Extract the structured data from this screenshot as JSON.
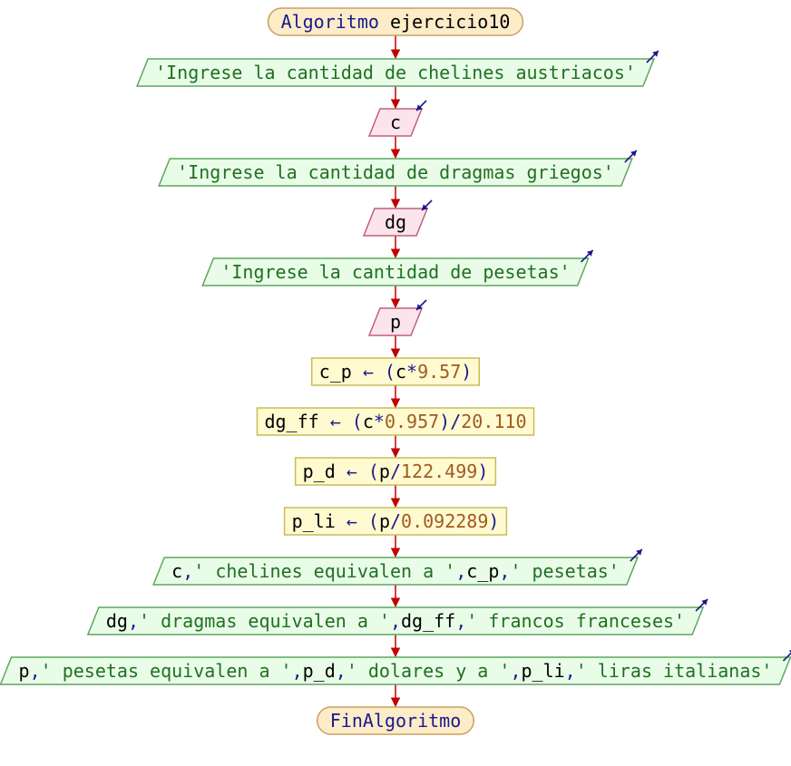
{
  "colors": {
    "edge": "#c00000",
    "terminal_fill": "#fcecc8",
    "terminal_stroke": "#c8a060",
    "output_fill": "#e8fce8",
    "output_stroke": "#5fa65f",
    "input_fill": "#fce4ec",
    "input_stroke": "#c0607a",
    "process_fill": "#fffad0",
    "process_stroke": "#c8bc58",
    "keyword": "#1a1a8c",
    "string": "#207020",
    "variable": "#000000",
    "number": "#a05a20",
    "io_arrow": "#1a1a8c"
  },
  "nodes": [
    {
      "id": "start",
      "type": "terminal",
      "tokens": [
        {
          "t": "Algoritmo",
          "k": "keyword"
        },
        {
          "t": " ejercicio10",
          "k": "variable"
        }
      ]
    },
    {
      "id": "out1",
      "type": "output",
      "tokens": [
        {
          "t": "'Ingrese la cantidad de chelines austriacos'",
          "k": "string"
        }
      ]
    },
    {
      "id": "in1",
      "type": "input",
      "tokens": [
        {
          "t": "c",
          "k": "variable"
        }
      ]
    },
    {
      "id": "out2",
      "type": "output",
      "tokens": [
        {
          "t": "'Ingrese la cantidad de dragmas griegos'",
          "k": "string"
        }
      ]
    },
    {
      "id": "in2",
      "type": "input",
      "tokens": [
        {
          "t": "dg",
          "k": "variable"
        }
      ]
    },
    {
      "id": "out3",
      "type": "output",
      "tokens": [
        {
          "t": "'Ingrese la cantidad de pesetas'",
          "k": "string"
        }
      ]
    },
    {
      "id": "in3",
      "type": "input",
      "tokens": [
        {
          "t": "p",
          "k": "variable"
        }
      ]
    },
    {
      "id": "proc1",
      "type": "process",
      "tokens": [
        {
          "t": "c_p",
          "k": "variable"
        },
        {
          "t": " ← (",
          "k": "keyword"
        },
        {
          "t": "c",
          "k": "variable"
        },
        {
          "t": "*",
          "k": "keyword"
        },
        {
          "t": "9.57",
          "k": "number"
        },
        {
          "t": ")",
          "k": "keyword"
        }
      ]
    },
    {
      "id": "proc2",
      "type": "process",
      "tokens": [
        {
          "t": "dg_ff",
          "k": "variable"
        },
        {
          "t": " ← (",
          "k": "keyword"
        },
        {
          "t": "c",
          "k": "variable"
        },
        {
          "t": "*",
          "k": "keyword"
        },
        {
          "t": "0.957",
          "k": "number"
        },
        {
          "t": ")/",
          "k": "keyword"
        },
        {
          "t": "20.110",
          "k": "number"
        }
      ]
    },
    {
      "id": "proc3",
      "type": "process",
      "tokens": [
        {
          "t": "p_d",
          "k": "variable"
        },
        {
          "t": " ← (",
          "k": "keyword"
        },
        {
          "t": "p",
          "k": "variable"
        },
        {
          "t": "/",
          "k": "keyword"
        },
        {
          "t": "122.499",
          "k": "number"
        },
        {
          "t": ")",
          "k": "keyword"
        }
      ]
    },
    {
      "id": "proc4",
      "type": "process",
      "tokens": [
        {
          "t": "p_li",
          "k": "variable"
        },
        {
          "t": " ← (",
          "k": "keyword"
        },
        {
          "t": "p",
          "k": "variable"
        },
        {
          "t": "/",
          "k": "keyword"
        },
        {
          "t": "0.092289",
          "k": "number"
        },
        {
          "t": ")",
          "k": "keyword"
        }
      ]
    },
    {
      "id": "out4",
      "type": "output",
      "tokens": [
        {
          "t": "c",
          "k": "variable"
        },
        {
          "t": ",",
          "k": "keyword"
        },
        {
          "t": "' chelines equivalen a '",
          "k": "string"
        },
        {
          "t": ",",
          "k": "keyword"
        },
        {
          "t": "c_p",
          "k": "variable"
        },
        {
          "t": ",",
          "k": "keyword"
        },
        {
          "t": "' pesetas'",
          "k": "string"
        }
      ]
    },
    {
      "id": "out5",
      "type": "output",
      "tokens": [
        {
          "t": "dg",
          "k": "variable"
        },
        {
          "t": ",",
          "k": "keyword"
        },
        {
          "t": "' dragmas equivalen a '",
          "k": "string"
        },
        {
          "t": ",",
          "k": "keyword"
        },
        {
          "t": "dg_ff",
          "k": "variable"
        },
        {
          "t": ",",
          "k": "keyword"
        },
        {
          "t": "' francos franceses'",
          "k": "string"
        }
      ]
    },
    {
      "id": "out6",
      "type": "output",
      "tokens": [
        {
          "t": "p",
          "k": "variable"
        },
        {
          "t": ",",
          "k": "keyword"
        },
        {
          "t": "' pesetas equivalen a '",
          "k": "string"
        },
        {
          "t": ",",
          "k": "keyword"
        },
        {
          "t": "p_d",
          "k": "variable"
        },
        {
          "t": ",",
          "k": "keyword"
        },
        {
          "t": "' dolares y a '",
          "k": "string"
        },
        {
          "t": ",",
          "k": "keyword"
        },
        {
          "t": "p_li",
          "k": "variable"
        },
        {
          "t": ",",
          "k": "keyword"
        },
        {
          "t": "' liras italianas'",
          "k": "string"
        }
      ]
    },
    {
      "id": "end",
      "type": "terminal",
      "tokens": [
        {
          "t": "FinAlgoritmo",
          "k": "keyword"
        }
      ]
    }
  ],
  "edges": [
    [
      "start",
      "out1"
    ],
    [
      "out1",
      "in1"
    ],
    [
      "in1",
      "out2"
    ],
    [
      "out2",
      "in2"
    ],
    [
      "in2",
      "out3"
    ],
    [
      "out3",
      "in3"
    ],
    [
      "in3",
      "proc1"
    ],
    [
      "proc1",
      "proc2"
    ],
    [
      "proc2",
      "proc3"
    ],
    [
      "proc3",
      "proc4"
    ],
    [
      "proc4",
      "out4"
    ],
    [
      "out4",
      "out5"
    ],
    [
      "out5",
      "out6"
    ],
    [
      "out6",
      "end"
    ]
  ]
}
